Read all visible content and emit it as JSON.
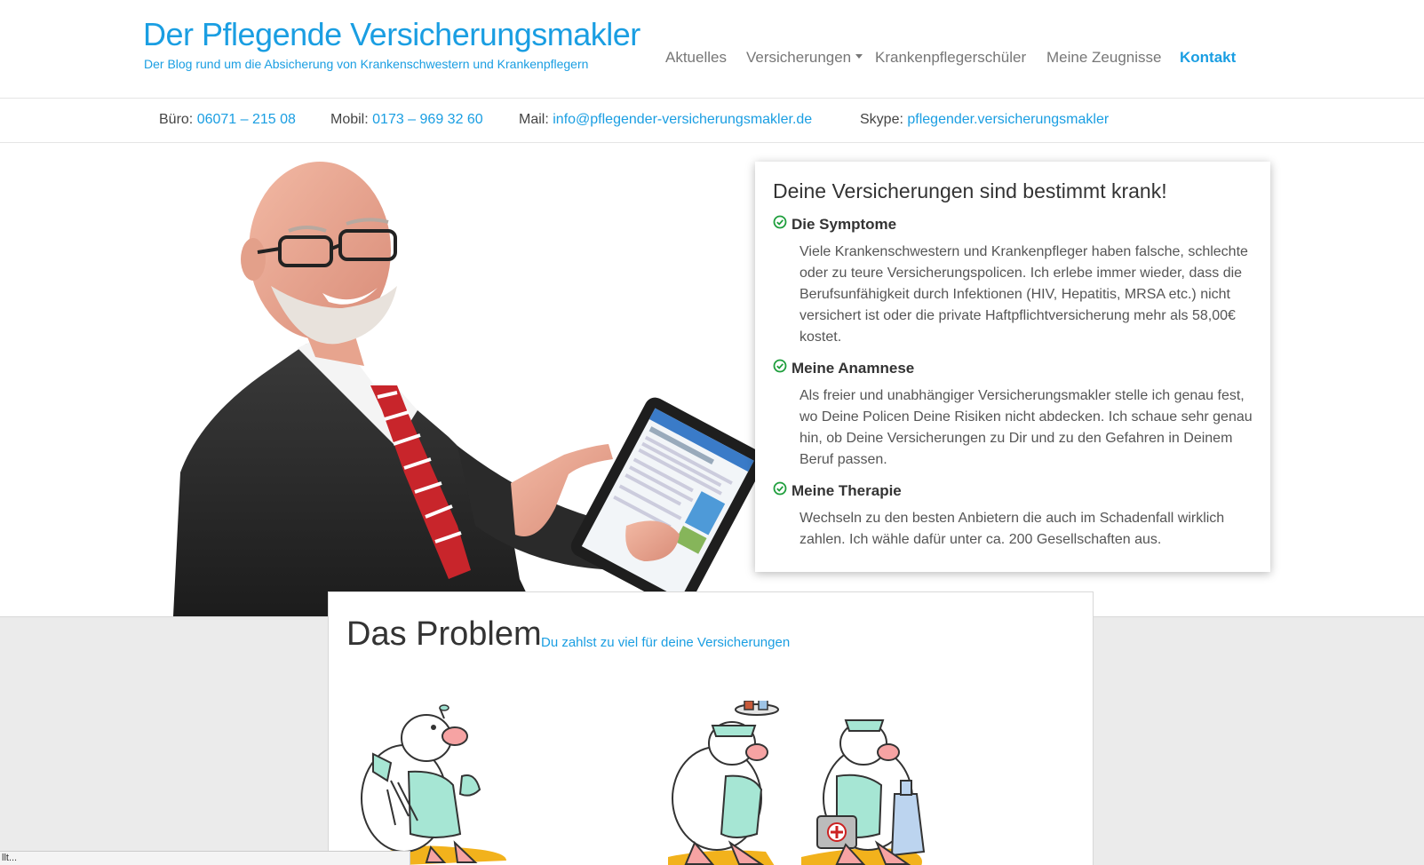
{
  "brand": {
    "title": "Der Pflegende Versicherungsmakler",
    "subtitle": "Der Blog rund um die Absicherung von Krankenschwestern und Krankenpflegern",
    "color": "#1a9ee2"
  },
  "nav": {
    "items": [
      {
        "label": "Aktuelles"
      },
      {
        "label": "Versicherungen"
      },
      {
        "label": "Krankenpflegerschüler"
      },
      {
        "label": "Meine Zeugnisse"
      },
      {
        "label": "Kontakt"
      }
    ]
  },
  "contact": {
    "buero_label": "Büro:",
    "buero_value": "06071 – 215 08",
    "mobil_label": "Mobil:",
    "mobil_value": "0173 – 969 32 60",
    "mail_label": "Mail:",
    "mail_value": "info@pflegender-versicherungsmakler.de",
    "skype_label": "Skype:",
    "skype_value": "pflegender.versicherungsmakler"
  },
  "card": {
    "title": "Deine Versicherungen sind bestimmt krank!",
    "items": [
      {
        "heading": "Die Symptome",
        "text": "Viele Krankenschwestern und Krankenpfleger haben falsche, schlechte oder zu teure Versicherungspolicen. Ich erlebe immer wieder, dass die Berufsunfähigkeit durch Infektionen (HIV, Hepatitis, MRSA etc.) nicht versichert ist oder die private Haftpflichtversicherung mehr als 58,00€ kostet."
      },
      {
        "heading": "Meine Anamnese",
        "text": "Als freier und unabhängiger Versicherungsmakler stelle ich genau fest, wo Deine Policen Deine Risiken nicht abdecken. Ich schaue sehr genau hin, ob Deine Versicherungen zu Dir und zu den Gefahren in Deinem Beruf passen."
      },
      {
        "heading": "Meine Therapie",
        "text": "Wechseln zu den besten Anbietern die auch im Schadenfall wirklich zahlen. Ich wähle dafür unter ca. 200 Gesellschaften aus."
      }
    ],
    "check_color": "#1e9e3c"
  },
  "problem": {
    "title": "Das Problem",
    "subtitle": "Du zahlst zu viel für deine Versicherungen"
  },
  "statusbar": {
    "text": "llt..."
  }
}
